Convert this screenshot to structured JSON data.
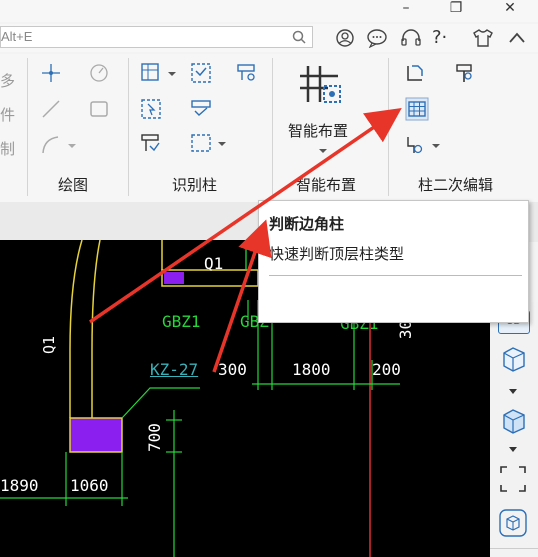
{
  "window": {
    "minimize_glyph": "–",
    "restore_glyph": "❐",
    "close_glyph": "✕"
  },
  "search": {
    "shortcut_text": "Alt+E"
  },
  "toolbar": {
    "help_label": "?·",
    "icons": [
      "search-icon",
      "user-icon",
      "chat-icon",
      "headset-icon",
      "help-icon",
      "shirt-icon",
      "collapse-icon"
    ]
  },
  "ribbon": {
    "groups": [
      {
        "label": "绘图"
      },
      {
        "label": "识别柱"
      },
      {
        "label": "智能布置"
      },
      {
        "label": "柱二次编辑"
      }
    ],
    "smart_layout_button": "智能布置",
    "left_partial_chars": [
      "多",
      "件",
      "制"
    ]
  },
  "tooltip": {
    "title": "判断边角柱",
    "description": "快速判断顶层柱类型"
  },
  "cad": {
    "labels": {
      "q1_top": "Q1",
      "q1_vertical": "Q1",
      "gbz1_a": "GBZ1",
      "gbz1_b": "GBZ",
      "gbz1_c": "GBZ1",
      "kz27": "KZ-27",
      "dim_300": "300",
      "dim_1800": "1800",
      "dim_200": "200",
      "dim_700": "700",
      "dim_1890": "1890",
      "dim_1060": "1060",
      "dim_30": "30"
    }
  },
  "rightbar": {
    "label_3d": "3D"
  },
  "colors": {
    "arrow": "#e8352a",
    "cad_yellow": "#e6d23a",
    "cad_green": "#27d63a",
    "cad_purple": "#8a1ff0",
    "cad_cyan": "#3ab0b8",
    "cad_red": "#e03030",
    "icon_blue": "#2d6fb6"
  }
}
